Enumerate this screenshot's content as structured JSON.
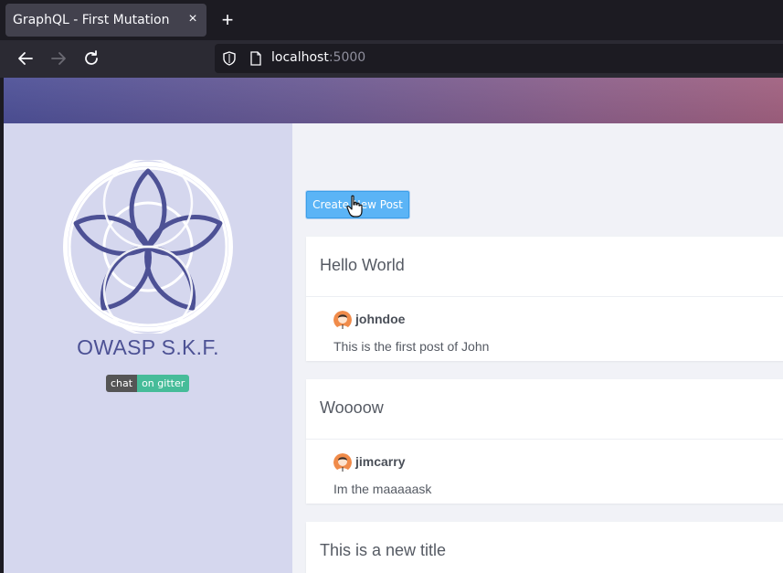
{
  "browser": {
    "tab_title": "GraphQL - First Mutation",
    "tab_close": "×",
    "new_tab": "+",
    "url_host": "localhost",
    "url_port": ":5000"
  },
  "sidebar": {
    "brand": "OWASP S.K.F.",
    "badge_left": "chat",
    "badge_right": "on gitter"
  },
  "main": {
    "create_button": "Create New Post",
    "posts": [
      {
        "title": "Hello World",
        "author": "johndoe",
        "text": "This is the first post of John"
      },
      {
        "title": "Woooow",
        "author": "jimcarry",
        "text": "Im the maaaaask"
      },
      {
        "title": "This is a new title"
      }
    ]
  },
  "colors": {
    "accent_button": "#5bb4f6",
    "brand_text": "#4c5194",
    "sidebar_bg": "#d5d7ee",
    "gitter_green": "#46bc99"
  }
}
